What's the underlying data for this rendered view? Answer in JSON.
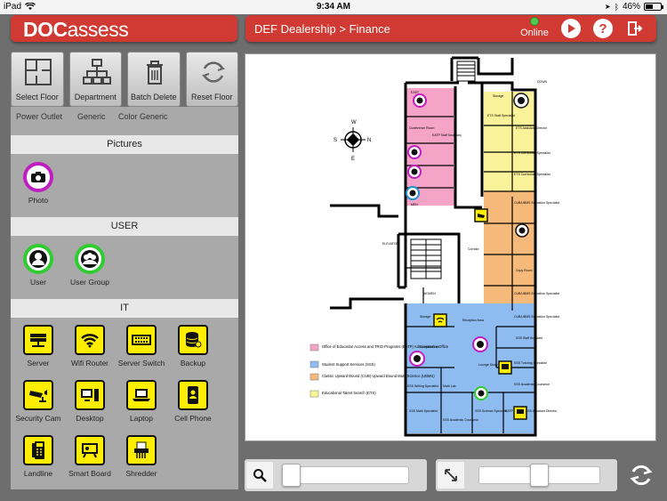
{
  "status_bar": {
    "device": "iPad",
    "time": "9:34 AM",
    "battery": "46%"
  },
  "header": {
    "logo_bold": "DOC",
    "logo_light": "assess",
    "breadcrumb": "DEF Dealership > Finance",
    "online_label": "Online"
  },
  "toolbar": [
    {
      "label": "Select Floor",
      "icon": "floorplan-icon"
    },
    {
      "label": "Department",
      "icon": "org-chart-icon"
    },
    {
      "label": "Batch Delete",
      "icon": "trash-icon"
    },
    {
      "label": "Reset Floor",
      "icon": "reset-icon"
    }
  ],
  "palette": {
    "cut_off_labels": [
      "Power Outlet",
      "Generic",
      "Color Generic"
    ],
    "sections": [
      {
        "title": "Pictures",
        "items": [
          {
            "label": "Photo",
            "icon": "camera-icon"
          }
        ]
      },
      {
        "title": "USER",
        "items": [
          {
            "label": "User",
            "icon": "user-icon"
          },
          {
            "label": "User Group",
            "icon": "user-group-icon"
          }
        ]
      },
      {
        "title": "IT",
        "items": [
          {
            "label": "Server",
            "icon": "server-icon"
          },
          {
            "label": "Wifi Router",
            "icon": "wifi-icon"
          },
          {
            "label": "Server Switch",
            "icon": "switch-icon"
          },
          {
            "label": "Backup",
            "icon": "backup-icon"
          },
          {
            "label": "Security Cam",
            "icon": "security-cam-icon"
          },
          {
            "label": "Desktop",
            "icon": "desktop-icon"
          },
          {
            "label": "Laptop",
            "icon": "laptop-icon"
          },
          {
            "label": "Cell Phone",
            "icon": "cell-phone-icon"
          },
          {
            "label": "Landline",
            "icon": "landline-icon"
          },
          {
            "label": "Smart Board",
            "icon": "smart-board-icon"
          },
          {
            "label": "Shredder",
            "icon": "shredder-icon"
          }
        ]
      }
    ]
  },
  "map": {
    "compass": {
      "n": "N",
      "s": "S",
      "e": "E",
      "w": "W"
    },
    "rooms": {
      "eatp": "EATP",
      "conference": "Conference Room",
      "eatp_staff": "EATP Staff Secretary",
      "men": "MEN",
      "women": "WOMEN",
      "storage": "Storage",
      "down": "DOWN",
      "ets_staff": "ETS Staff Specialist",
      "ets_assist": "ETS Assistant Director",
      "ets_curr1": "ETS Curriculum Specialist",
      "ets_curr2": "ETS Curriculum Specialist",
      "cub1": "CUB/UBMS Education Specialist",
      "cub2": "CUB/UBMS Education Specialist",
      "cub3": "CUB/UBMS Education Specialist",
      "copy": "Copy Room",
      "corridor": "Corridor",
      "elevator": "ELEVATOR",
      "storage2": "Storage",
      "reception": "Reception Area",
      "computer_lab": "Computer Lab",
      "lounge": "Lounge Study Area",
      "sss_staff": "SSS Staff Assistant",
      "sss_tutoring": "SSS Tutoring Specialist",
      "sss_academic": "SSS Academic Counselor",
      "sss_writing": "SSS Writing Specialist",
      "math_lab": "Math Lab",
      "sss_math": "SSS Math Specialist",
      "sss_science": "SSS Science Specialist",
      "sss_counselor": "SSS Academic Counselor",
      "eatp_director": "EATP Director SSS Assistant Director"
    },
    "legend": [
      {
        "label": "Office of Education Access and TRIO Programs (EATP) Administrative Office",
        "color": "#f5a3c7"
      },
      {
        "label": "Student Support Services (SSS)",
        "color": "#8fbcf0"
      },
      {
        "label": "Classic Upward Bound (CUB) Upward Bound Math/Science (UBMS)",
        "color": "#f5b97a"
      },
      {
        "label": "Educational Talent Search (ETS)",
        "color": "#fbf39a"
      }
    ]
  },
  "controls": {
    "zoom_value": 0.0,
    "rotation_value": 0.5
  },
  "colors": {
    "brand_red": "#d13a32",
    "online_green": "#4fc94f",
    "device_yellow": "#ffee00",
    "photo_purple": "#c01ec0",
    "user_green": "#2fcc2f"
  }
}
